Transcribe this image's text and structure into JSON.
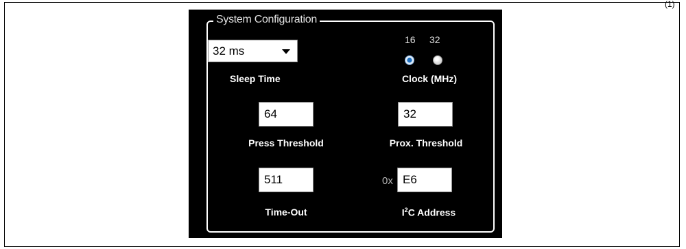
{
  "corner_mark": "(1)",
  "group": {
    "title": "System Configuration"
  },
  "sleep_time": {
    "value": "32 ms",
    "label": "Sleep Time"
  },
  "clock": {
    "label": "Clock (MHz)",
    "options": [
      "16",
      "32"
    ],
    "selected": "16"
  },
  "press_threshold": {
    "value": "64",
    "label": "Press Threshold"
  },
  "prox_threshold": {
    "value": "32",
    "label": "Prox. Threshold"
  },
  "time_out": {
    "value": "511",
    "label": "Time-Out"
  },
  "i2c_address": {
    "prefix": "0x",
    "value": "E6",
    "label_main": "I",
    "label_sup": "2",
    "label_rest": "C Address"
  }
}
